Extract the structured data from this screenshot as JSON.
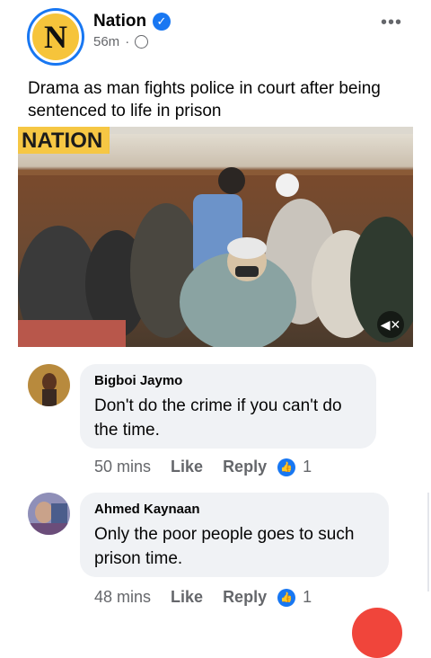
{
  "post": {
    "page_name": "Nation",
    "avatar_letter": "N",
    "time": "56m",
    "text": "Drama as man fights police in court after being sentenced to life in prison",
    "video": {
      "watermark": "NATION",
      "sound": "muted"
    }
  },
  "comments": [
    {
      "author": "Bigboi Jaymo",
      "text": "Don't do the crime if you can't do the time.",
      "time": "50 mins",
      "like_label": "Like",
      "reply_label": "Reply",
      "reaction_count": "1"
    },
    {
      "author": "Ahmed Kaynaan",
      "text": "Only the poor people goes to such prison time.",
      "time": "48 mins",
      "like_label": "Like",
      "reply_label": "Reply",
      "reaction_count": "1"
    }
  ],
  "colors": {
    "accent": "#1877f2",
    "nation_yellow": "#f6c43b",
    "bubble": "#f0f2f5",
    "meta": "#65676b"
  },
  "icons": [
    "verified-icon",
    "globe-icon",
    "more-options-icon",
    "mute-icon",
    "like-reaction-icon"
  ]
}
